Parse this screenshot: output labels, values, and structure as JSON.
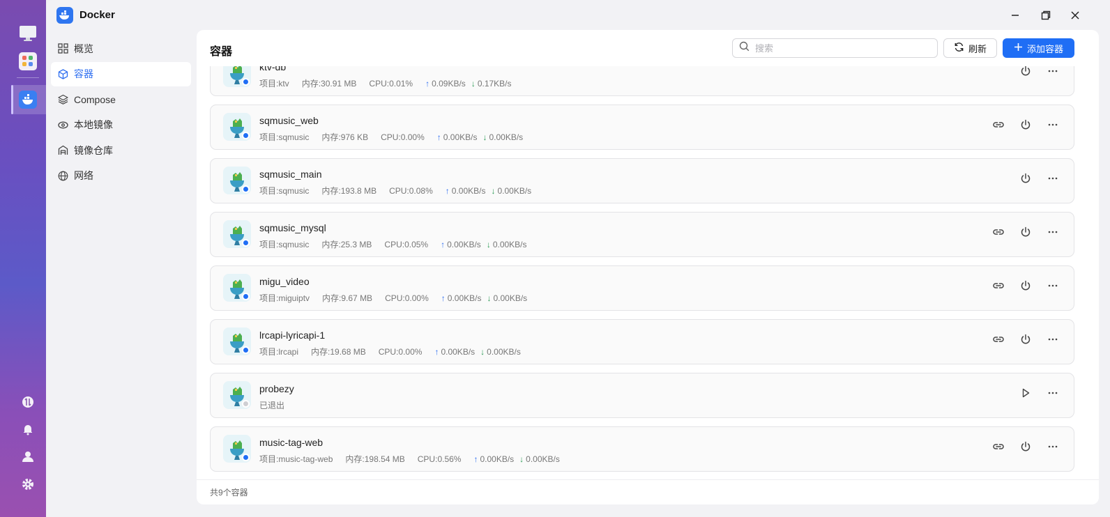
{
  "app": {
    "title": "Docker"
  },
  "nav": [
    {
      "label": "概览",
      "icon": "grid-icon"
    },
    {
      "label": "容器",
      "icon": "cube-icon",
      "active": true
    },
    {
      "label": "Compose",
      "icon": "layers-icon"
    },
    {
      "label": "本地镜像",
      "icon": "eye-icon"
    },
    {
      "label": "镜像仓库",
      "icon": "warehouse-icon"
    },
    {
      "label": "网络",
      "icon": "globe-icon"
    }
  ],
  "panel": {
    "title": "容器",
    "search_placeholder": "搜索",
    "refresh_label": "刷新",
    "add_label": "添加容器",
    "footer": "共9个容器"
  },
  "labels": {
    "project": "项目: ",
    "memory": "内存: ",
    "cpu": "CPU: "
  },
  "containers": [
    {
      "name": "ktv-db",
      "project": "ktv",
      "memory": "30.91 MB",
      "cpu": "0.01%",
      "up": "0.09KB/s",
      "down": "0.17KB/s",
      "running": true,
      "has_link": false
    },
    {
      "name": "sqmusic_web",
      "project": "sqmusic",
      "memory": "976 KB",
      "cpu": "0.00%",
      "up": "0.00KB/s",
      "down": "0.00KB/s",
      "running": true,
      "has_link": true
    },
    {
      "name": "sqmusic_main",
      "project": "sqmusic",
      "memory": "193.8 MB",
      "cpu": "0.08%",
      "up": "0.00KB/s",
      "down": "0.00KB/s",
      "running": true,
      "has_link": false
    },
    {
      "name": "sqmusic_mysql",
      "project": "sqmusic",
      "memory": "25.3 MB",
      "cpu": "0.05%",
      "up": "0.00KB/s",
      "down": "0.00KB/s",
      "running": true,
      "has_link": true
    },
    {
      "name": "migu_video",
      "project": "miguiptv",
      "memory": "9.67 MB",
      "cpu": "0.00%",
      "up": "0.00KB/s",
      "down": "0.00KB/s",
      "running": true,
      "has_link": true
    },
    {
      "name": "lrcapi-lyricapi-1",
      "project": "lrcapi",
      "memory": "19.68 MB",
      "cpu": "0.00%",
      "up": "0.00KB/s",
      "down": "0.00KB/s",
      "running": true,
      "has_link": true
    },
    {
      "name": "probezy",
      "status_text": "已退出",
      "running": false,
      "has_link": false
    },
    {
      "name": "music-tag-web",
      "project": "music-tag-web",
      "memory": "198.54 MB",
      "cpu": "0.56%",
      "up": "0.00KB/s",
      "down": "0.00KB/s",
      "running": true,
      "has_link": true
    }
  ],
  "colors": {
    "accent": "#1f6ef5",
    "running": "#1f6ef5",
    "stopped": "#cfcfd3",
    "up_arrow": "#2f6ff0",
    "down_arrow": "#2a9a54"
  }
}
